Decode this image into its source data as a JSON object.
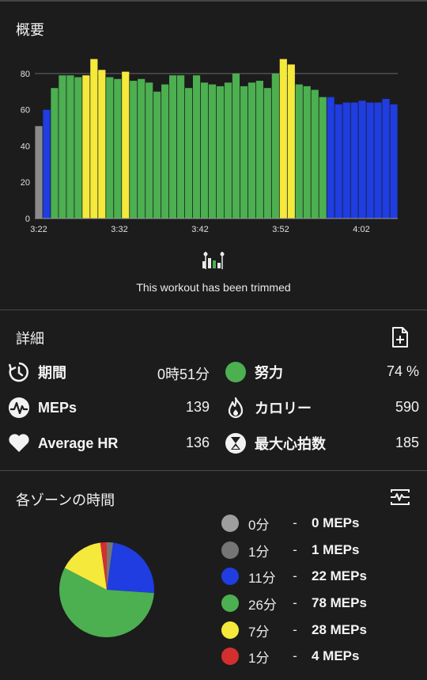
{
  "overview": {
    "title": "概要",
    "trim_message": "This workout has been trimmed"
  },
  "chart_data": {
    "type": "bar",
    "ylim": [
      0,
      90
    ],
    "y_ticks": [
      "0",
      "20",
      "40",
      "60",
      "80"
    ],
    "x_ticks": [
      "3:22",
      "3:32",
      "3:42",
      "3:52",
      "4:02"
    ],
    "zone_colors": {
      "gray": "#8a8a8a",
      "blue": "#1f3de0",
      "green": "#4caf50",
      "yellow": "#f5e93c"
    },
    "bars": [
      {
        "value": 51,
        "zone": "gray"
      },
      {
        "value": 60,
        "zone": "blue"
      },
      {
        "value": 72,
        "zone": "green"
      },
      {
        "value": 79,
        "zone": "green"
      },
      {
        "value": 79,
        "zone": "green"
      },
      {
        "value": 78,
        "zone": "green"
      },
      {
        "value": 79,
        "zone": "yellow"
      },
      {
        "value": 88,
        "zone": "yellow"
      },
      {
        "value": 82,
        "zone": "yellow"
      },
      {
        "value": 78,
        "zone": "green"
      },
      {
        "value": 77,
        "zone": "green"
      },
      {
        "value": 81,
        "zone": "yellow"
      },
      {
        "value": 76,
        "zone": "green"
      },
      {
        "value": 77,
        "zone": "green"
      },
      {
        "value": 75,
        "zone": "green"
      },
      {
        "value": 70,
        "zone": "green"
      },
      {
        "value": 74,
        "zone": "green"
      },
      {
        "value": 79,
        "zone": "green"
      },
      {
        "value": 79,
        "zone": "green"
      },
      {
        "value": 72,
        "zone": "green"
      },
      {
        "value": 79,
        "zone": "green"
      },
      {
        "value": 75,
        "zone": "green"
      },
      {
        "value": 74,
        "zone": "green"
      },
      {
        "value": 73,
        "zone": "green"
      },
      {
        "value": 75,
        "zone": "green"
      },
      {
        "value": 80,
        "zone": "green"
      },
      {
        "value": 73,
        "zone": "green"
      },
      {
        "value": 75,
        "zone": "green"
      },
      {
        "value": 76,
        "zone": "green"
      },
      {
        "value": 72,
        "zone": "green"
      },
      {
        "value": 80,
        "zone": "green"
      },
      {
        "value": 88,
        "zone": "yellow"
      },
      {
        "value": 85,
        "zone": "yellow"
      },
      {
        "value": 74,
        "zone": "green"
      },
      {
        "value": 73,
        "zone": "green"
      },
      {
        "value": 71,
        "zone": "green"
      },
      {
        "value": 67,
        "zone": "green"
      },
      {
        "value": 67,
        "zone": "blue"
      },
      {
        "value": 63,
        "zone": "blue"
      },
      {
        "value": 64,
        "zone": "blue"
      },
      {
        "value": 64,
        "zone": "blue"
      },
      {
        "value": 65,
        "zone": "blue"
      },
      {
        "value": 64,
        "zone": "blue"
      },
      {
        "value": 64,
        "zone": "blue"
      },
      {
        "value": 66,
        "zone": "blue"
      },
      {
        "value": 63,
        "zone": "blue"
      }
    ]
  },
  "details": {
    "title": "詳細",
    "stats": [
      {
        "label": "期間",
        "value": "0時51分",
        "icon": "duration-icon"
      },
      {
        "label": "努力",
        "value": "74 %",
        "icon": "effort-icon",
        "color": "#4caf50"
      },
      {
        "label": "MEPs",
        "value": "139",
        "icon": "meps-icon"
      },
      {
        "label": "カロリー",
        "value": "590",
        "icon": "calorie-flame-icon"
      },
      {
        "label": "Average HR",
        "value": "136",
        "icon": "heart-icon"
      },
      {
        "label": "最大心拍数",
        "value": "185",
        "icon": "hourglass-icon"
      }
    ]
  },
  "zones": {
    "title": "各ゾーンの時間",
    "items": [
      {
        "minutes": "0分",
        "dash": "-",
        "meps": "0 MEPs",
        "color": "#9e9e9e",
        "share": 0
      },
      {
        "minutes": "1分",
        "dash": "-",
        "meps": "1 MEPs",
        "color": "#757575",
        "share": 1
      },
      {
        "minutes": "11分",
        "dash": "-",
        "meps": "22 MEPs",
        "color": "#1f3de0",
        "share": 11
      },
      {
        "minutes": "26分",
        "dash": "-",
        "meps": "78 MEPs",
        "color": "#4caf50",
        "share": 26
      },
      {
        "minutes": "7分",
        "dash": "-",
        "meps": "28 MEPs",
        "color": "#f5e93c",
        "share": 7
      },
      {
        "minutes": "1分",
        "dash": "-",
        "meps": "4 MEPs",
        "color": "#d32f2f",
        "share": 1
      }
    ]
  }
}
